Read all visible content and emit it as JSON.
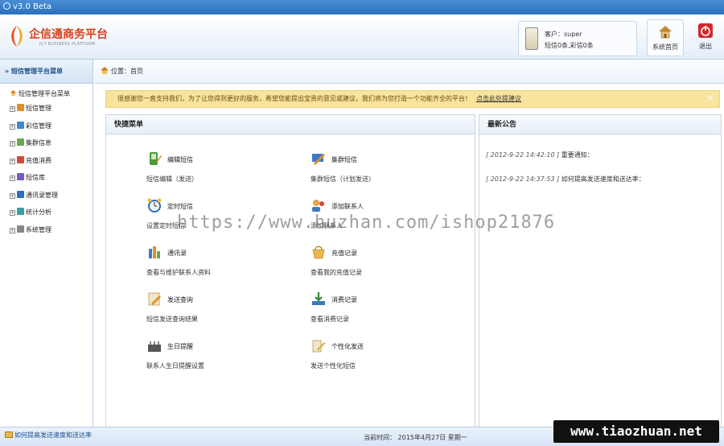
{
  "window": {
    "title": "v3.0 Beta"
  },
  "header": {
    "logo_title": "企信通商务平台",
    "logo_subtitle": "ICT BUSINESS PLATFORM",
    "user_label": "客户：super",
    "user_quota": "短信0条,彩信0条",
    "home_label": "系统首页",
    "exit_label": "退出"
  },
  "sidebar": {
    "title": "» 短信管理平台菜单",
    "root": "短信管理平台菜单",
    "items": [
      {
        "label": "短信管理",
        "icon": "sms-icon"
      },
      {
        "label": "彩信管理",
        "icon": "mms-icon"
      },
      {
        "label": "集群信息",
        "icon": "group-icon"
      },
      {
        "label": "充值消费",
        "icon": "recharge-icon"
      },
      {
        "label": "短信库",
        "icon": "library-icon"
      },
      {
        "label": "通讯录管理",
        "icon": "contacts-icon"
      },
      {
        "label": "统计分析",
        "icon": "stats-icon"
      },
      {
        "label": "系统管理",
        "icon": "settings-icon"
      }
    ]
  },
  "breadcrumb": {
    "text": "位置：首页"
  },
  "notice": {
    "text": "很感谢您一直支持我们，为了让您得到更好的服务，希望您能提出宝贵的意见或建议，我们将为您打造一个功能齐全的平台！",
    "link": "点击此处提建议",
    "close": "×"
  },
  "quick_menu": {
    "title": "快捷菜单",
    "items": [
      {
        "title": "编辑短信",
        "desc": "短信编辑（发送）",
        "icon": "edit-sms-icon"
      },
      {
        "title": "集群短信",
        "desc": "集群短信（计划发送）",
        "icon": "group-sms-icon"
      },
      {
        "title": "定时短信",
        "desc": "设置定时短信",
        "icon": "alarm-clock-icon"
      },
      {
        "title": "添加联系人",
        "desc": "添加联系人",
        "icon": "add-contact-icon"
      },
      {
        "title": "通讯录",
        "desc": "查看与维护联系人资料",
        "icon": "address-book-icon"
      },
      {
        "title": "充值记录",
        "desc": "查看我的充值记录",
        "icon": "recharge-record-icon"
      },
      {
        "title": "发送查询",
        "desc": "短信发送查询结果",
        "icon": "send-query-icon"
      },
      {
        "title": "消费记录",
        "desc": "查看消费记录",
        "icon": "consume-record-icon"
      },
      {
        "title": "生日提醒",
        "desc": "联系人生日提醒设置",
        "icon": "birthday-icon"
      },
      {
        "title": "个性化发送",
        "desc": "发送个性化短信",
        "icon": "custom-send-icon"
      }
    ]
  },
  "news": {
    "title": "最新公告",
    "items": [
      {
        "date": "[ 2012-9-22 14:42:10 ]",
        "text": "重要通知："
      },
      {
        "date": "[ 2012-9-22 14:37:53 ]",
        "text": "如何提高发送速度和送达率："
      }
    ]
  },
  "watermark": "https://www.huzhan.com/ishop21876",
  "status": {
    "left": "如何提高发送速度和送达率；重要通知；",
    "time": "当前时间： 2015年4月27日 星期一"
  },
  "site_mark": "www.tiaozhuan.net",
  "colors": {
    "accent": "#2c6fbd",
    "notice_bg": "#f8e49a",
    "logo_red": "#d9411f"
  }
}
